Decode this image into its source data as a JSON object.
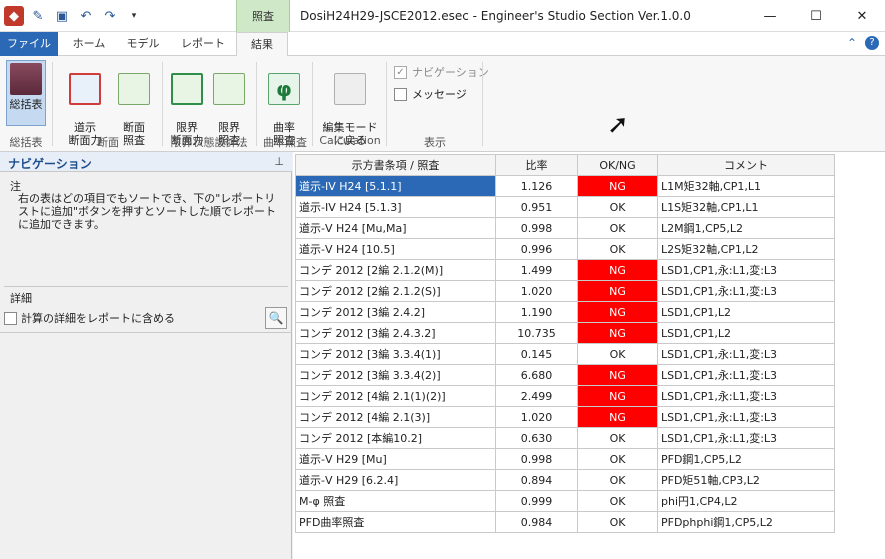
{
  "window": {
    "title": "DosiH24H29-JSCE2012.esec - Engineer's Studio Section Ver.1.0.0",
    "context_tab": "照査",
    "controls": {
      "minimize": "—",
      "maximize": "☐",
      "close": "✕"
    }
  },
  "quick_access": [
    "app-icon",
    "new-icon",
    "save-icon",
    "undo-icon",
    "redo-icon",
    "customize-icon"
  ],
  "tabs": [
    {
      "label": "ファイル"
    },
    {
      "label": "ホーム"
    },
    {
      "label": "モデル"
    },
    {
      "label": "レポート"
    },
    {
      "label": "結果"
    }
  ],
  "ribbon": {
    "buttons": {
      "summary": "総括表",
      "road_force": "道示\n断面力",
      "section_check": "断面\n照査",
      "limit_force": "限界\n断面力",
      "limit_check": "限界\n照査",
      "curvature_check": "曲率\n照査",
      "back_to_edit": "編集モード\nに戻る"
    },
    "groups": {
      "summary": "総括表",
      "section": "断面",
      "limit_state": "限界状態設計法",
      "curvature": "曲率照査",
      "calculation": "Calculation",
      "display": "表示"
    },
    "checks": {
      "navigation": "ナビゲーション",
      "message": "メッセージ"
    }
  },
  "navigation": {
    "title": "ナビゲーション",
    "note_label": "注",
    "note_text": "右の表はどの項目でもソートでき、下の\"レポートリストに追加\"ボタンを押すとソートした順でレポートに追加できます。",
    "detail_label": "詳細",
    "detail_checkbox": "計算の詳細をレポートに含める"
  },
  "grid": {
    "headers": {
      "item": "示方書条項 / 照査",
      "ratio": "比率",
      "ok": "OK/NG",
      "comment": "コメント"
    },
    "rows": [
      {
        "item": "道示-IV H24 [5.1.1]",
        "ratio": "1.126",
        "ok": "NG",
        "comment": "L1M矩32軸,CP1,L1"
      },
      {
        "item": "道示-IV H24 [5.1.3]",
        "ratio": "0.951",
        "ok": "OK",
        "comment": "L1S矩32軸,CP1,L1"
      },
      {
        "item": "道示-V H24 [Mu,Ma]",
        "ratio": "0.998",
        "ok": "OK",
        "comment": "L2M鋼1,CP5,L2"
      },
      {
        "item": "道示-V H24 [10.5]",
        "ratio": "0.996",
        "ok": "OK",
        "comment": "L2S矩32軸,CP1,L2"
      },
      {
        "item": "コンデ 2012 [2編 2.1.2(M)]",
        "ratio": "1.499",
        "ok": "NG",
        "comment": "LSD1,CP1,永:L1,変:L3"
      },
      {
        "item": "コンデ 2012 [2編 2.1.2(S)]",
        "ratio": "1.020",
        "ok": "NG",
        "comment": "LSD1,CP1,永:L1,変:L3"
      },
      {
        "item": "コンデ 2012 [3編 2.4.2]",
        "ratio": "1.190",
        "ok": "NG",
        "comment": "LSD1,CP1,L2"
      },
      {
        "item": "コンデ 2012 [3編 2.4.3.2]",
        "ratio": "10.735",
        "ok": "NG",
        "comment": "LSD1,CP1,L2"
      },
      {
        "item": "コンデ 2012 [3編 3.3.4(1)]",
        "ratio": "0.145",
        "ok": "OK",
        "comment": "LSD1,CP1,永:L1,変:L3"
      },
      {
        "item": "コンデ 2012 [3編 3.3.4(2)]",
        "ratio": "6.680",
        "ok": "NG",
        "comment": "LSD1,CP1,永:L1,変:L3"
      },
      {
        "item": "コンデ 2012 [4編 2.1(1)(2)]",
        "ratio": "2.499",
        "ok": "NG",
        "comment": "LSD1,CP1,永:L1,変:L3"
      },
      {
        "item": "コンデ 2012 [4編 2.1(3)]",
        "ratio": "1.020",
        "ok": "NG",
        "comment": "LSD1,CP1,永:L1,変:L3"
      },
      {
        "item": "コンデ 2012 [本編10.2]",
        "ratio": "0.630",
        "ok": "OK",
        "comment": "LSD1,CP1,永:L1,変:L3"
      },
      {
        "item": "道示-V H29 [Mu]",
        "ratio": "0.998",
        "ok": "OK",
        "comment": "PFD鋼1,CP5,L2"
      },
      {
        "item": "道示-V H29 [6.2.4]",
        "ratio": "0.894",
        "ok": "OK",
        "comment": "PFD矩51軸,CP3,L2"
      },
      {
        "item": "M-φ 照査",
        "ratio": "0.999",
        "ok": "OK",
        "comment": "phi円1,CP4,L2"
      },
      {
        "item": "PFD曲率照査",
        "ratio": "0.984",
        "ok": "OK",
        "comment": "PFDphphi鋼1,CP5,L2"
      }
    ]
  },
  "colors": {
    "accent": "#2b68b5",
    "ng": "#ff0000",
    "context": "#cfe8c8"
  }
}
